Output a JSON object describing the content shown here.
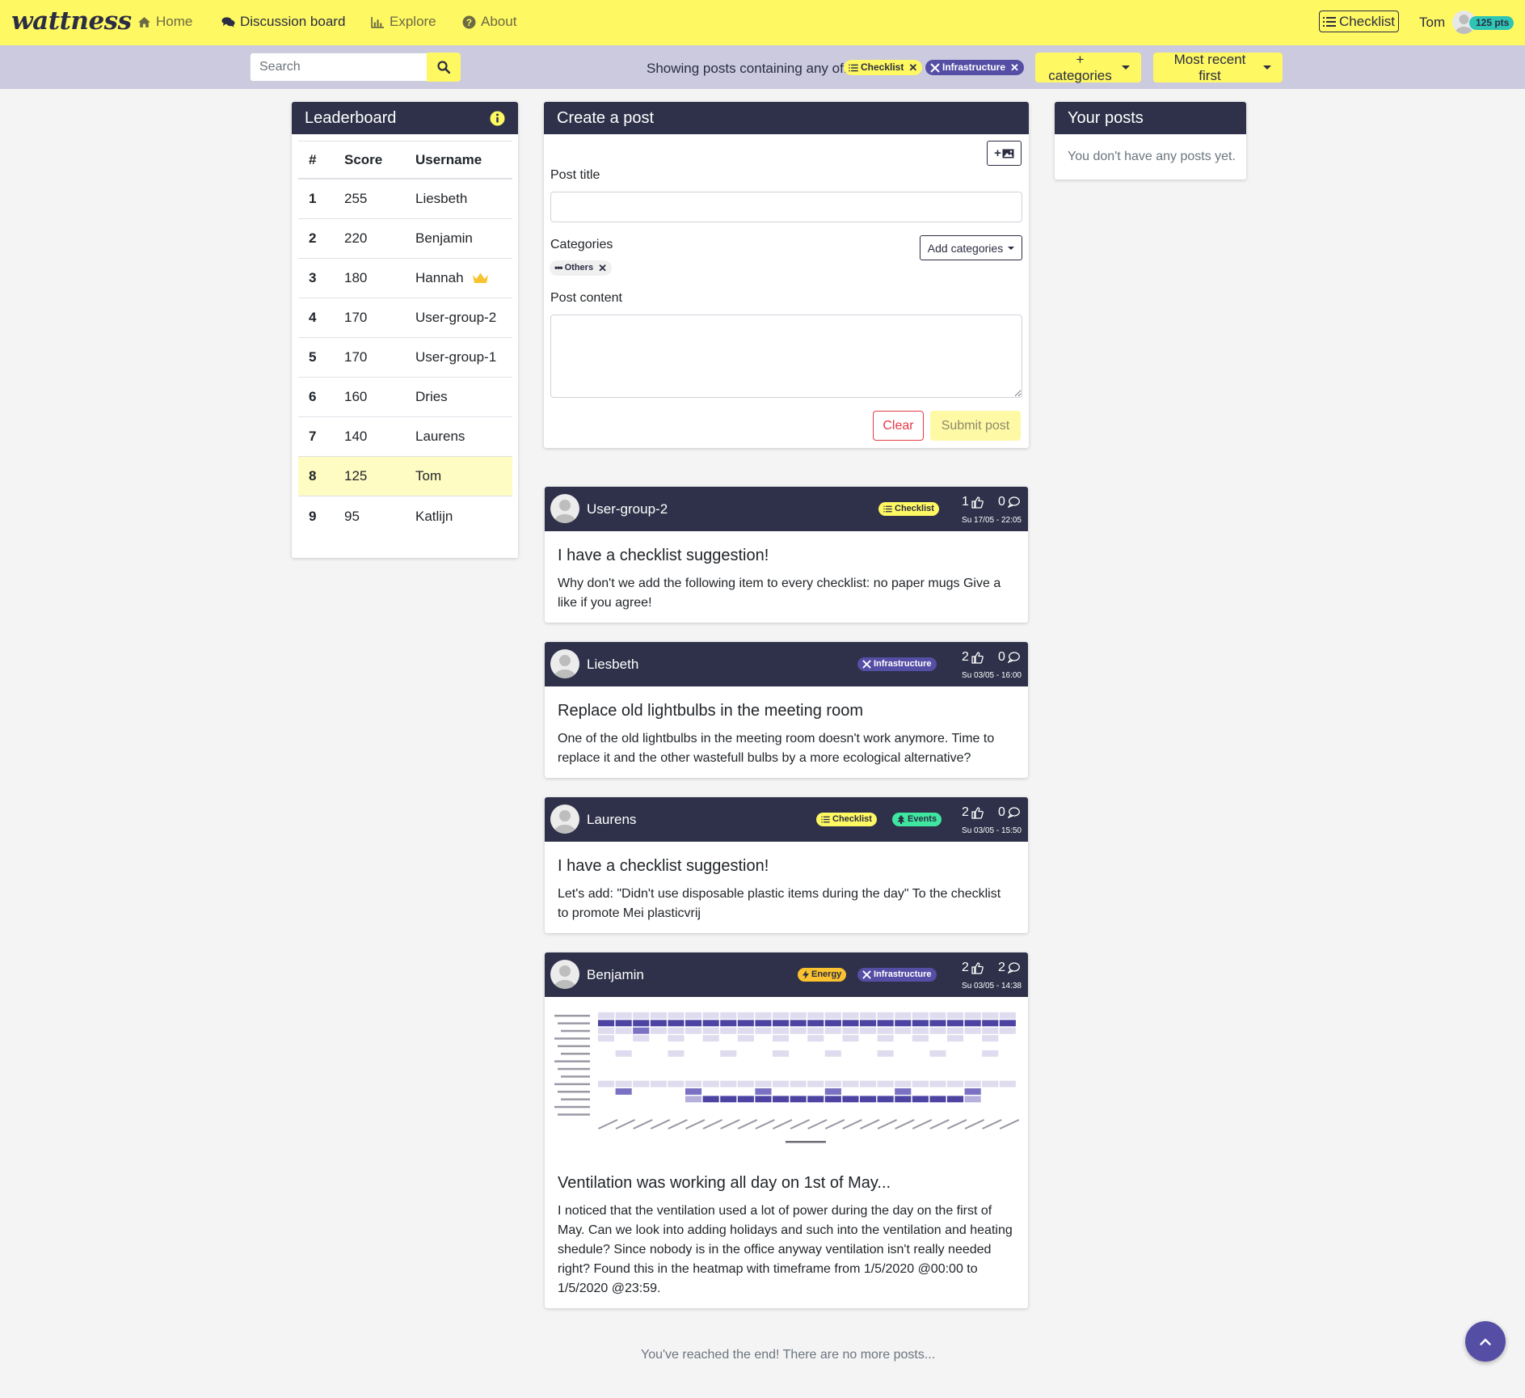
{
  "app": {
    "logo": "wattness"
  },
  "nav": {
    "links": [
      "Home",
      "Discussion board",
      "Explore",
      "About"
    ],
    "checklist": "Checklist",
    "user": "Tom",
    "points": "125 pts"
  },
  "filter": {
    "search_placeholder": "Search",
    "showing": "Showing posts containing any of:",
    "chips": [
      "Checklist",
      "Infrastructure"
    ],
    "categories_btn": "+ categories",
    "sort_btn": "Most recent first"
  },
  "leaderboard": {
    "title": "Leaderboard",
    "headers": [
      "#",
      "Score",
      "Username"
    ],
    "rows": [
      {
        "rank": "1",
        "score": "255",
        "name": "Liesbeth"
      },
      {
        "rank": "2",
        "score": "220",
        "name": "Benjamin"
      },
      {
        "rank": "3",
        "score": "180",
        "name": "Hannah"
      },
      {
        "rank": "4",
        "score": "170",
        "name": "User-group-2"
      },
      {
        "rank": "5",
        "score": "170",
        "name": "User-group-1"
      },
      {
        "rank": "6",
        "score": "160",
        "name": "Dries"
      },
      {
        "rank": "7",
        "score": "140",
        "name": "Laurens"
      },
      {
        "rank": "8",
        "score": "125",
        "name": "Tom"
      },
      {
        "rank": "9",
        "score": "95",
        "name": "Katlijn"
      }
    ]
  },
  "create": {
    "title": "Create a post",
    "image_btn": "+",
    "post_title_label": "Post title",
    "categories_label": "Categories",
    "add_categories": "Add categories",
    "selected_category": "Others",
    "content_label": "Post content",
    "clear": "Clear",
    "submit": "Submit post"
  },
  "your_posts": {
    "title": "Your posts",
    "empty": "You don't have any posts yet."
  },
  "posts": [
    {
      "user": "User-group-2",
      "tags": [
        "Checklist"
      ],
      "likes": "1",
      "comments": "0",
      "date": "Su 17/05 - 22:05",
      "title": "I have a checklist suggestion!",
      "body": "Why don't we add the following item to every checklist: no paper mugs Give a like if you agree!"
    },
    {
      "user": "Liesbeth",
      "tags": [
        "Infrastructure"
      ],
      "likes": "2",
      "comments": "0",
      "date": "Su 03/05 - 16:00",
      "title": "Replace old lightbulbs in the meeting room",
      "body": "One of the old lightbulbs in the meeting room doesn't work anymore. Time to replace it and the other wastefull bulbs by a more ecological alternative?"
    },
    {
      "user": "Laurens",
      "tags": [
        "Checklist",
        "Events"
      ],
      "likes": "2",
      "comments": "0",
      "date": "Su 03/05 - 15:50",
      "title": "I have a checklist suggestion!",
      "body": "Let's add: \"Didn't use disposable plastic items during the day\" To the checklist to promote Mei plasticvrij"
    },
    {
      "user": "Benjamin",
      "tags": [
        "Energy",
        "Infrastructure"
      ],
      "likes": "2",
      "comments": "2",
      "date": "Su 03/05 - 14:38",
      "title": "Ventilation was working all day on 1st of May...",
      "body": "I noticed that the ventilation used a lot of power during the day on the first of May. Can we look into adding holidays and such into the ventilation and heating shedule? Since nobody is in the office anyway ventilation isn't really needed right? Found this in the heatmap with timeframe from 1/5/2020 @00:00 to 1/5/2020 @23:59."
    }
  ],
  "end_text": "You've reached the end! There are no more posts...",
  "colors": {
    "brand_yellow": "#fef862",
    "dark_header": "#2e3149",
    "filter_bar": "#cbcade",
    "purple": "#554ea5",
    "green": "#3ee6a0",
    "orange": "#f9c22e",
    "danger": "#e63946"
  },
  "icons": [
    "home-icon",
    "comments-icon",
    "chart-icon",
    "question-icon",
    "list-icon",
    "search-icon",
    "info-icon",
    "crown-icon",
    "image-icon",
    "thumbs-up-icon",
    "comment-icon",
    "tools-icon",
    "bolt-icon",
    "tree-icon",
    "chevron-up-icon"
  ]
}
